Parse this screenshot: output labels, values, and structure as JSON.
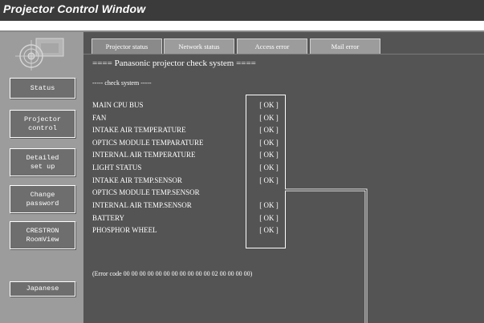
{
  "window": {
    "title": "Projector Control Window"
  },
  "sidebar": {
    "buttons": [
      {
        "label": "Status"
      },
      {
        "label": "Projector\ncontrol"
      },
      {
        "label": "Detailed\nset up"
      },
      {
        "label": "Change\npassword"
      },
      {
        "label": "CRESTRON\nRoomView"
      },
      {
        "label": "Japanese"
      }
    ]
  },
  "tabs": [
    {
      "label": "Projector status"
    },
    {
      "label": "Network status"
    },
    {
      "label": "Access error"
    },
    {
      "label": "Mail error"
    }
  ],
  "main": {
    "heading": "==== Panasonic projector check system ====",
    "subheading": "----- check system -----",
    "checks": [
      {
        "label": "MAIN CPU BUS",
        "result": "[ OK ]"
      },
      {
        "label": "FAN",
        "result": "[ OK ]"
      },
      {
        "label": "INTAKE AIR TEMPERATURE",
        "result": "[ OK ]"
      },
      {
        "label": "OPTICS MODULE TEMPARATURE",
        "result": "[ OK ]"
      },
      {
        "label": "INTERNAL AIR TEMPERATURE",
        "result": "[ OK ]"
      },
      {
        "label": "LIGHT STATUS",
        "result": "[ OK ]"
      },
      {
        "label": "INTAKE AIR TEMP.SENSOR",
        "result": "[ OK ]"
      },
      {
        "label": "OPTICS MODULE TEMP.SENSOR",
        "result": ""
      },
      {
        "label": "INTERNAL AIR TEMP.SENSOR",
        "result": "[ OK ]"
      },
      {
        "label": "BATTERY",
        "result": "[ OK ]"
      },
      {
        "label": "PHOSPHOR WHEEL",
        "result": "[ OK ]"
      }
    ],
    "error_code": "(Error code 00 00 00 00 00 00 00 00 00 00 00 02 00 00 00 00)"
  },
  "colors": {
    "titlebar": "#3b3b3b",
    "sidebar": "#9c9c9c",
    "content": "#545454",
    "button": "#6e6e6e",
    "text": "#ffffff"
  }
}
